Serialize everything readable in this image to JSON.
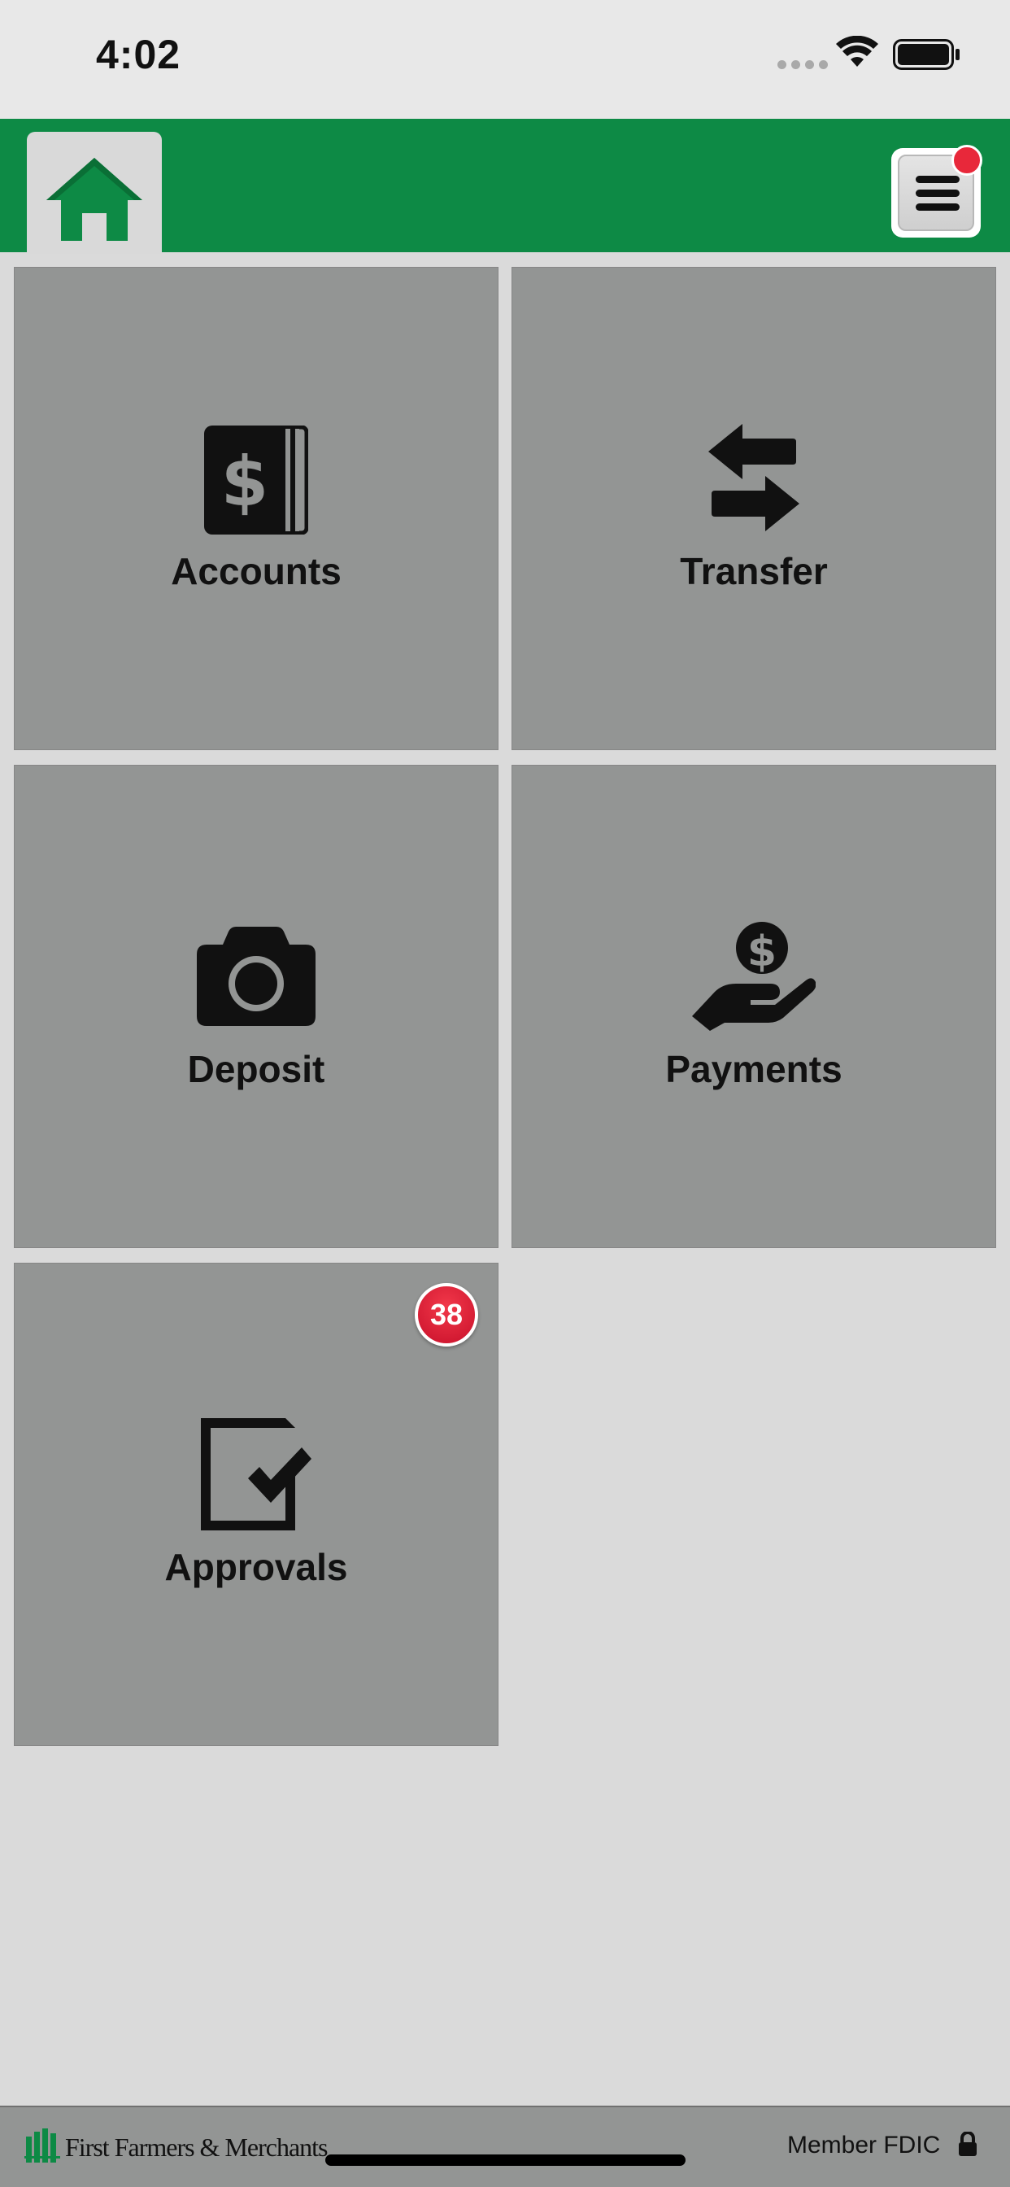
{
  "status_bar": {
    "time": "4:02"
  },
  "header": {
    "home_icon": "home-icon",
    "menu_icon": "hamburger-menu-icon",
    "menu_notification": true,
    "brand_color": "#0d8a45"
  },
  "tiles": [
    {
      "label": "Accounts",
      "icon": "dollar-bill-stack-icon"
    },
    {
      "label": "Transfer",
      "icon": "transfer-arrows-icon"
    },
    {
      "label": "Deposit",
      "icon": "camera-icon"
    },
    {
      "label": "Payments",
      "icon": "hand-coin-icon"
    },
    {
      "label": "Approvals",
      "icon": "checked-document-icon",
      "badge": "38"
    }
  ],
  "footer": {
    "brand": "First Farmers & Merchants",
    "fdic": "Member FDIC",
    "lock_icon": "lock-icon"
  },
  "colors": {
    "tile_bg": "#939594",
    "page_bg": "#dadada",
    "badge": "#e8283a"
  }
}
